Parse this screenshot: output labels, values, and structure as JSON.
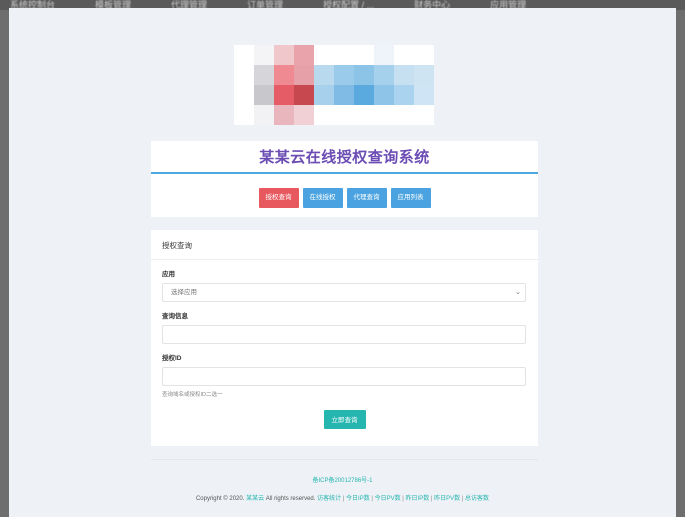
{
  "background_tabs": [
    "系统控制台",
    "模板管理",
    "代理管理",
    "订单管理",
    "授权配置 / ...",
    "财务中心",
    "应用管理"
  ],
  "header": {
    "title": "某某云在线授权查询系统",
    "nav": [
      {
        "label": "授权查询",
        "color": "#e8585f"
      },
      {
        "label": "在线授权",
        "color": "#4aa3e0"
      },
      {
        "label": "代理查询",
        "color": "#4aa3e0"
      },
      {
        "label": "应用列表",
        "color": "#4aa3e0"
      }
    ]
  },
  "form": {
    "heading": "授权查询",
    "app_label": "应用",
    "app_selected": "选择应用",
    "query_label": "查询信息",
    "query_value": "",
    "id_label": "授权ID",
    "id_value": "",
    "hint": "查询域名或授权ID二选一",
    "submit_label": "立即查询"
  },
  "footer": {
    "icp": "备ICP备20012786号-1",
    "copyright_prefix": "Copyright © 2020.",
    "brand": "某某云",
    "rights": "All rights reserved.",
    "links": [
      "访客统计",
      "今日IP数",
      "今日PV数",
      "昨日IP数",
      "昨日PV数",
      "总访客数"
    ]
  },
  "colors": {
    "accent": "#26b6b0",
    "title": "#6b4db3",
    "nav_active": "#e8585f",
    "nav_default": "#4aa3e0"
  }
}
